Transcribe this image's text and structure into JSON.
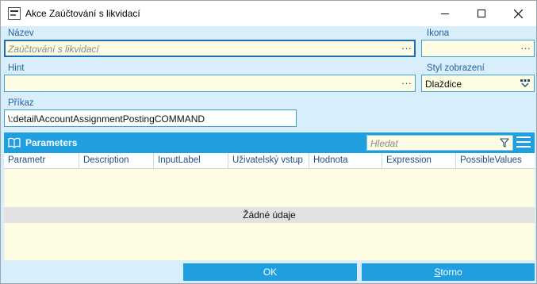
{
  "window": {
    "title": "Akce Zaúčtování s likvidací",
    "minimize_label": "—",
    "maximize_label": "☐",
    "close_label": "✕"
  },
  "form": {
    "nazev": {
      "label": "Název",
      "placeholder": "Zaúčtování s likvidací",
      "value": "",
      "button": "···"
    },
    "ikona": {
      "label": "Ikona",
      "value": "",
      "button": "···"
    },
    "hint": {
      "label": "Hint",
      "value": "",
      "button": "···"
    },
    "styl": {
      "label": "Styl zobrazení",
      "value": "Dlaždice",
      "icon": "dropdown-icon"
    },
    "prikaz": {
      "label": "Příkaz",
      "value": "\\:detail\\AccountAssignmentPostingCOMMAND"
    }
  },
  "parameters": {
    "title": "Parameters",
    "search_placeholder": "Hledat",
    "columns": [
      "Parametr",
      "Description",
      "InputLabel",
      "Uživatelský vstup",
      "Hodnota",
      "Expression",
      "PossibleValues"
    ],
    "empty_text": "Žádné údaje"
  },
  "buttons": {
    "ok": "OK",
    "storno_first": "S",
    "storno_rest": "torno"
  },
  "colors": {
    "accent": "#1f9fe0",
    "field_bg": "#fefde4",
    "window_bg": "#d9eefb",
    "label": "#2a5fa0"
  }
}
